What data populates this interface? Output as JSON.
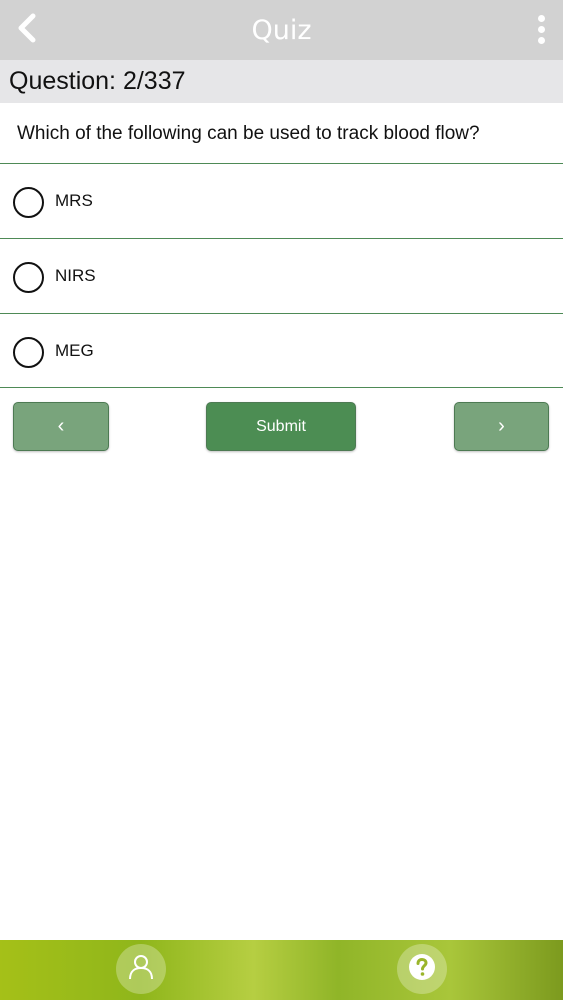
{
  "header": {
    "title": "Quiz",
    "back_icon": "chevron-left-icon",
    "menu_icon": "more-vertical-icon"
  },
  "question": {
    "counter": "Question: 2/337",
    "text": "Which of the following can be used to track blood flow?",
    "options": [
      {
        "label": "MRS",
        "selected": false
      },
      {
        "label": "NIRS",
        "selected": false
      },
      {
        "label": "MEG",
        "selected": false
      }
    ]
  },
  "controls": {
    "prev_label": "‹",
    "submit_label": "Submit",
    "next_label": "›"
  },
  "bottom_nav": {
    "profile_icon": "user-icon",
    "help_icon": "help-circle-icon"
  },
  "colors": {
    "accent": "#4c8d53",
    "accent_light": "#79a47c",
    "divider": "#4e8a56",
    "header_bg": "#d2d2d2"
  }
}
